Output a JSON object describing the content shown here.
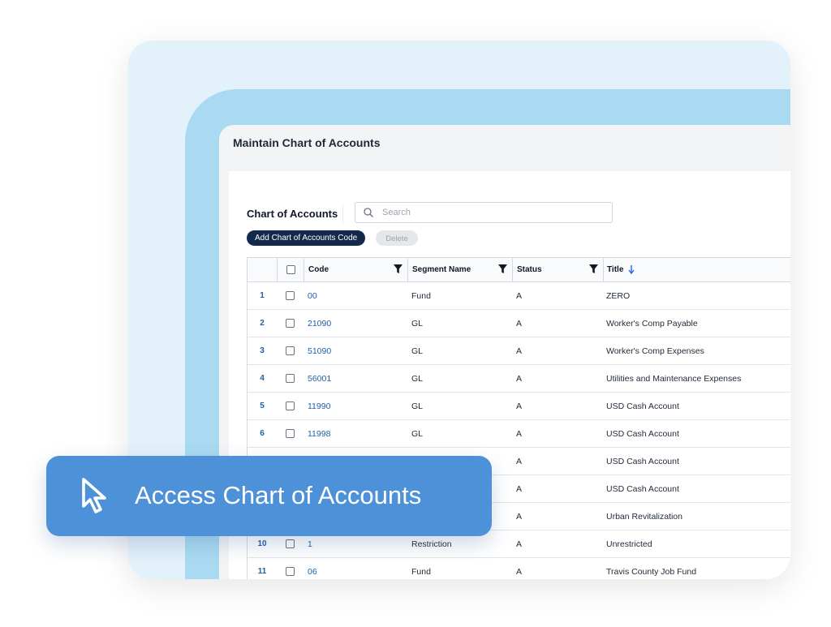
{
  "window": {
    "title": "Maintain Chart of Accounts"
  },
  "panel": {
    "title": "Chart of Accounts",
    "search_placeholder": "Search",
    "add_button": "Add Chart of Accounts Code",
    "delete_button": "Delete"
  },
  "table": {
    "columns": {
      "code": "Code",
      "segment": "Segment Name",
      "status": "Status",
      "title": "Title"
    },
    "sort": {
      "column": "Title",
      "direction": "ascending"
    },
    "rows": [
      {
        "index": "1",
        "code": "00",
        "segment": "Fund",
        "status": "A",
        "title": "ZERO"
      },
      {
        "index": "2",
        "code": "21090",
        "segment": "GL",
        "status": "A",
        "title": "Worker's Comp Payable"
      },
      {
        "index": "3",
        "code": "51090",
        "segment": "GL",
        "status": "A",
        "title": "Worker's Comp Expenses"
      },
      {
        "index": "4",
        "code": "56001",
        "segment": "GL",
        "status": "A",
        "title": "Utilities and Maintenance Expenses"
      },
      {
        "index": "5",
        "code": "11990",
        "segment": "GL",
        "status": "A",
        "title": "USD Cash Account"
      },
      {
        "index": "6",
        "code": "11998",
        "segment": "GL",
        "status": "A",
        "title": "USD Cash Account"
      },
      {
        "index": "",
        "code": "",
        "segment": "",
        "status": "A",
        "title": "USD Cash Account"
      },
      {
        "index": "",
        "code": "",
        "segment": "",
        "status": "A",
        "title": "USD Cash Account"
      },
      {
        "index": "",
        "code": "",
        "segment": "",
        "status": "A",
        "title": "Urban Revitalization"
      },
      {
        "index": "10",
        "code": "1",
        "segment": "Restriction",
        "status": "A",
        "title": "Unrestricted"
      },
      {
        "index": "11",
        "code": "06",
        "segment": "Fund",
        "status": "A",
        "title": "Travis County Job Fund"
      }
    ]
  },
  "banner": {
    "text": "Access Chart of Accounts",
    "icon": "cursor-arrow-icon"
  },
  "colors": {
    "banner": "#4d92d8",
    "primary_button": "#13294b",
    "link": "#1f5fa8",
    "frame": "#a9daf1",
    "card": "#e3f1fa"
  }
}
